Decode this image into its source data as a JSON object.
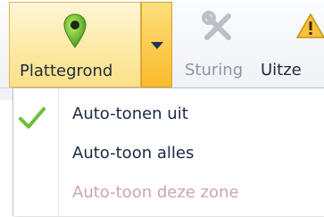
{
  "ribbon": {
    "plattegrond_label": "Plattegrond",
    "sturing_label": "Sturing",
    "uitzet_label": "Uitze"
  },
  "menu": {
    "items": [
      {
        "label": "Auto-tonen uit",
        "checked": true,
        "enabled": true
      },
      {
        "label": "Auto-toon alles",
        "checked": false,
        "enabled": true
      },
      {
        "label": "Auto-toon deze zone",
        "checked": false,
        "enabled": false
      }
    ]
  },
  "colors": {
    "accent_gold": "#fcc94a",
    "pin_green": "#7cc33c",
    "check_green": "#6cbf3a",
    "disabled_text": "#c8a6b2"
  }
}
